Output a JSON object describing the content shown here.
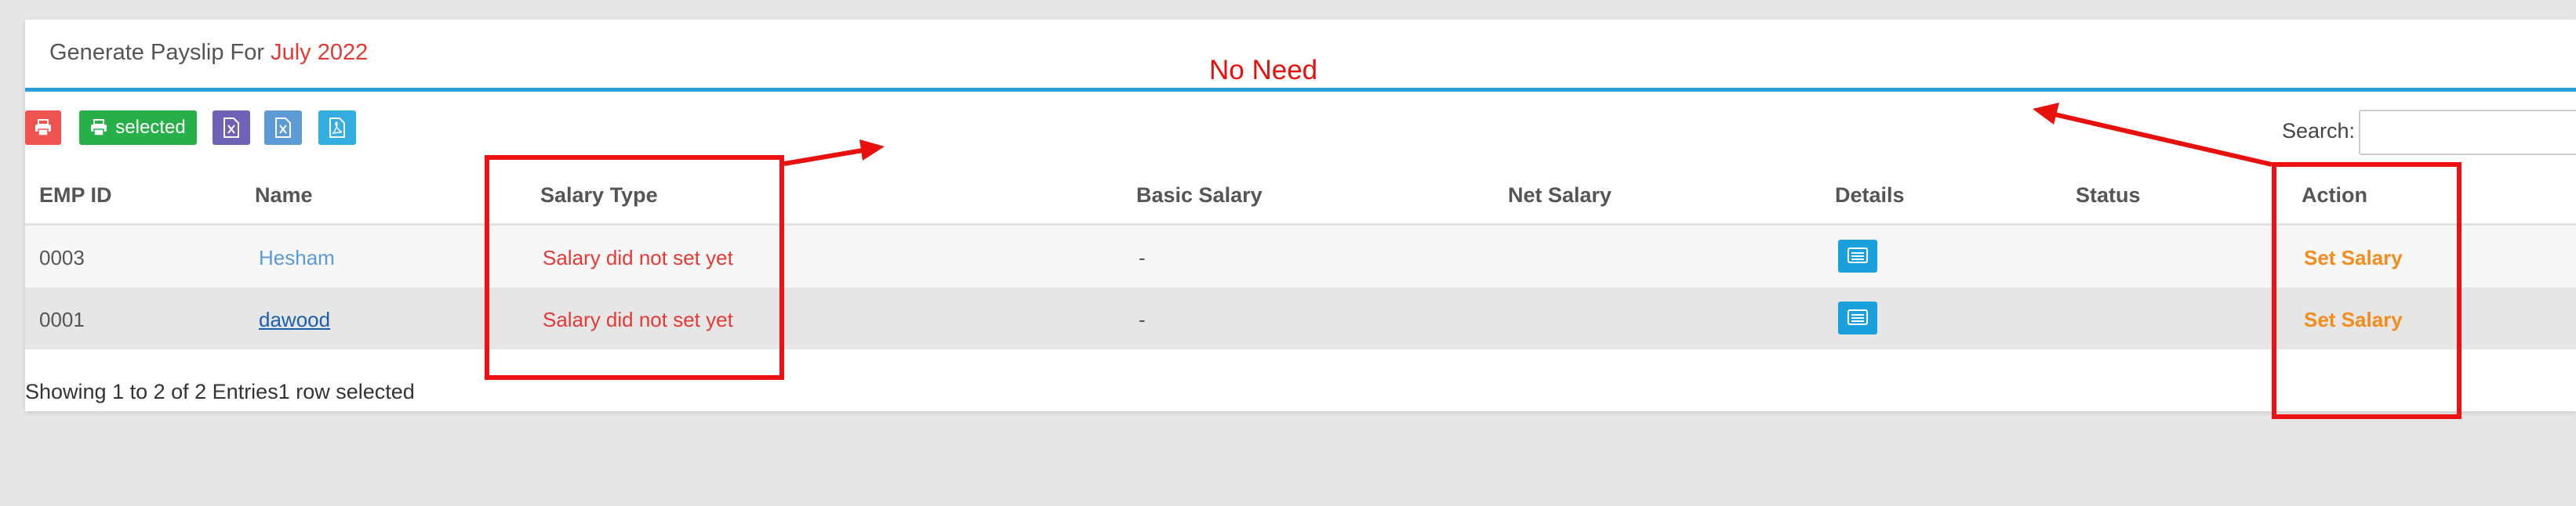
{
  "header": {
    "title_prefix": "Generate Payslip For ",
    "title_month": "July 2022"
  },
  "annotation": {
    "note": "No Need",
    "color": "#e8100c"
  },
  "toolbar": {
    "print_icon": "print-icon",
    "selected_label": "selected",
    "excel_icon": "excel-icon",
    "csv_icon": "excel-icon",
    "pdf_icon": "pdf-icon",
    "colors": {
      "print": "#ef5350",
      "selected": "#27b049",
      "excel": "#6d62b5",
      "csv": "#5c9bd6",
      "pdf": "#34aee0"
    }
  },
  "search": {
    "label": "Search:",
    "value": ""
  },
  "table": {
    "columns": [
      "EMP ID",
      "Name",
      "Salary Type",
      "Basic Salary",
      "Net Salary",
      "Details",
      "Status",
      "Action"
    ],
    "rows": [
      {
        "emp_id": "0003",
        "name": "Hesham",
        "salary_type": "Salary did not set yet",
        "basic_salary": "-",
        "net_salary": "",
        "details_icon": "list-icon",
        "status": "",
        "action": "Set Salary"
      },
      {
        "emp_id": "0001",
        "name": "dawood",
        "salary_type": "Salary did not set yet",
        "basic_salary": "-",
        "net_salary": "",
        "details_icon": "list-icon",
        "status": "",
        "action": "Set Salary"
      }
    ]
  },
  "footer": {
    "info": "Showing 1 to 2 of 2 Entries1 row selected"
  }
}
